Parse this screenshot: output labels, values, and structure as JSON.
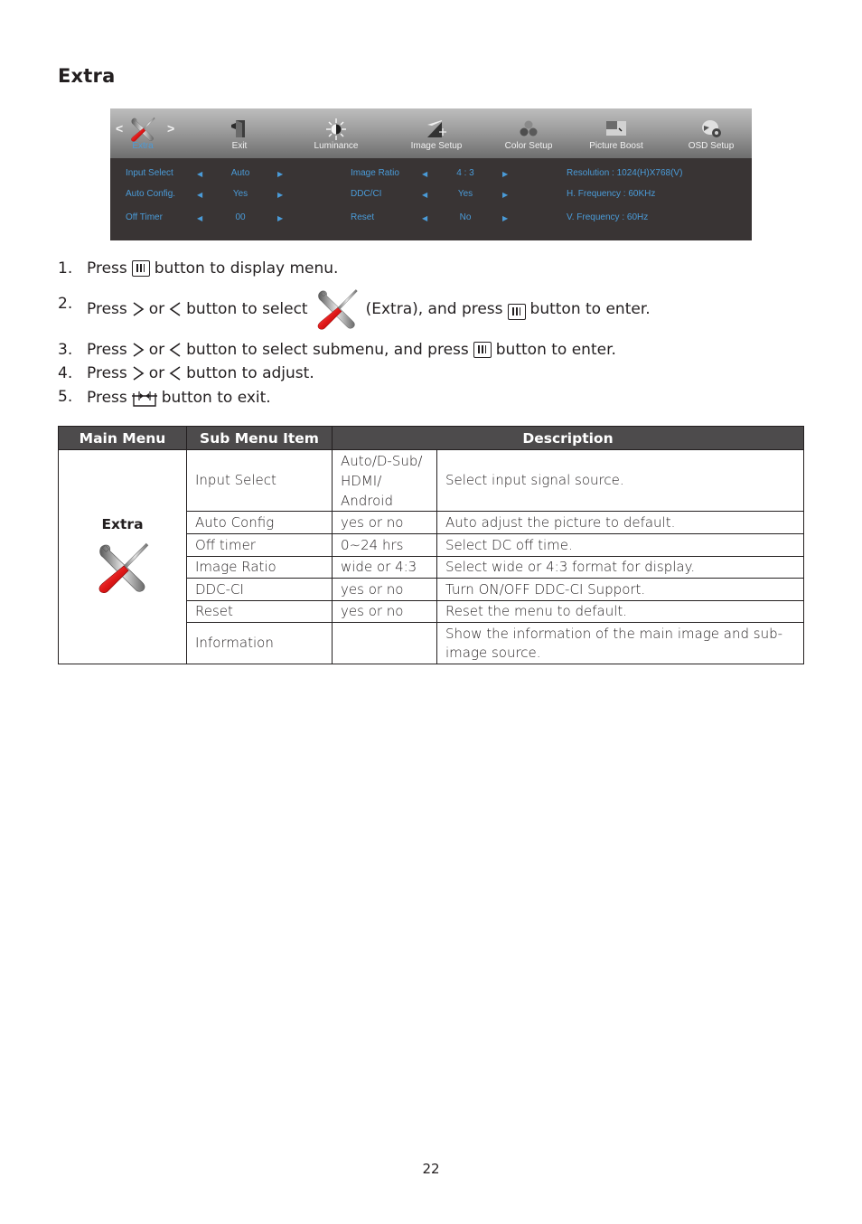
{
  "section_title": "Extra",
  "osd": {
    "tabs": [
      {
        "label": "Extra",
        "icon": "tools-icon",
        "active": true
      },
      {
        "label": "Exit",
        "icon": "exit-door-icon",
        "active": false
      },
      {
        "label": "Luminance",
        "icon": "sun-icon",
        "active": false
      },
      {
        "label": "Image Setup",
        "icon": "image-setup-icon",
        "active": false
      },
      {
        "label": "Color Setup",
        "icon": "color-balls-icon",
        "active": false
      },
      {
        "label": "Picture Boost",
        "icon": "picture-boost-icon",
        "active": false
      },
      {
        "label": "OSD Setup",
        "icon": "osd-setup-icon",
        "active": false
      }
    ],
    "nav_left": "<",
    "nav_right": ">",
    "items_col1": [
      {
        "label": "Input Select",
        "value": "Auto"
      },
      {
        "label": "Auto Config.",
        "value": "Yes"
      },
      {
        "label": "Off Timer",
        "value": "00"
      }
    ],
    "items_col2": [
      {
        "label": "Image Ratio",
        "value": "4 : 3"
      },
      {
        "label": "DDC/CI",
        "value": "Yes"
      },
      {
        "label": "Reset",
        "value": "No"
      }
    ],
    "info": [
      "Resolution : 1024(H)X768(V)",
      "H. Frequency : 60KHz",
      "V. Frequency : 60Hz"
    ],
    "arrow_left": "◀",
    "arrow_right": "▶",
    "colors": {
      "text": "#4a9bd8",
      "panel": "#393434"
    }
  },
  "steps": [
    {
      "num": "1.",
      "parts": [
        "Press",
        "button to display menu."
      ]
    },
    {
      "num": "2.",
      "parts": [
        "Press",
        "or",
        "button to select",
        "(Extra), and press",
        "button to enter."
      ]
    },
    {
      "num": "3.",
      "parts": [
        "Press",
        "or",
        "button to select submenu, and press",
        "button to enter."
      ]
    },
    {
      "num": "4.",
      "parts": [
        "Press",
        "or",
        "button to adjust."
      ]
    },
    {
      "num": "5.",
      "parts": [
        "Press",
        "button to exit."
      ]
    }
  ],
  "table": {
    "headers": [
      "Main Menu",
      "Sub Menu Item",
      "Description"
    ],
    "main_menu": "Extra",
    "rows": [
      {
        "item": "Input Select",
        "range": "Auto/D-Sub/ HDMI/ Android",
        "desc": "Select input signal source."
      },
      {
        "item": "Auto Config",
        "range": "yes or no",
        "desc": "Auto adjust the picture to default."
      },
      {
        "item": "Off timer",
        "range": "0~24 hrs",
        "desc": "Select DC off time."
      },
      {
        "item": "Image Ratio",
        "range": "wide or 4:3",
        "desc": "Select wide or 4:3 format for display."
      },
      {
        "item": "DDC-CI",
        "range": "yes or no",
        "desc": "Turn ON/OFF DDC-CI Support."
      },
      {
        "item": "Reset",
        "range": "yes or no",
        "desc": "Reset the menu to default."
      },
      {
        "item": "Information",
        "range": "",
        "desc": "Show the information of the main image and sub-image source."
      }
    ]
  },
  "page_number": "22"
}
